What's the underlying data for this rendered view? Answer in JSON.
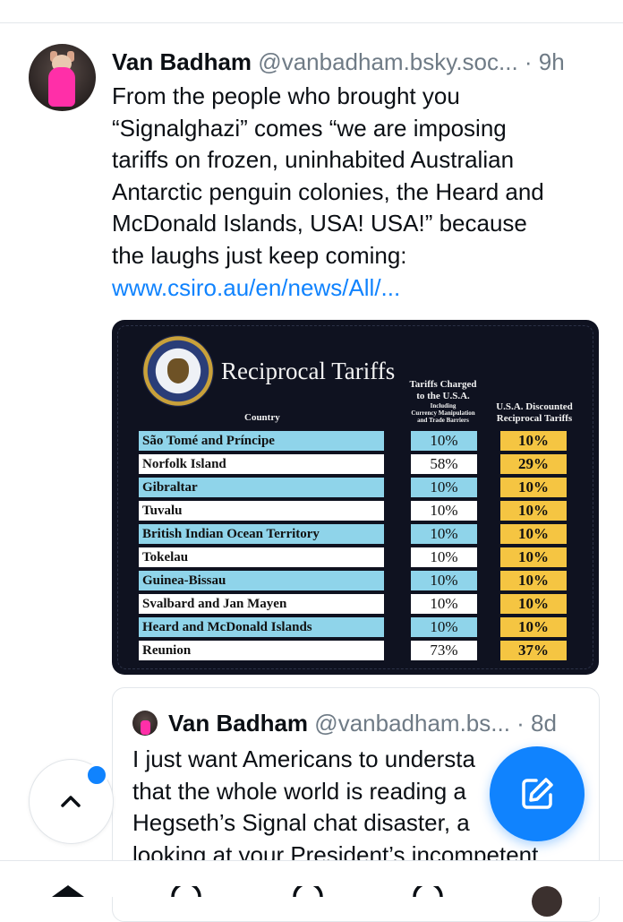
{
  "post": {
    "author": "Van Badham",
    "handle": "@vanbadham.bsky.soc...",
    "time": "· 9h",
    "text_lines": [
      "From the people who brought you",
      "“Signalghazi” comes “we are imposing",
      "tariffs on frozen, uninhabited Australian",
      "Antarctic penguin colonies, the Heard and",
      "McDonald Islands, USA! USA!” because",
      "the laughs just keep coming:"
    ],
    "link": "www.csiro.au/en/news/All/..."
  },
  "embed": {
    "title": "Reciprocal Tariffs",
    "col_country": "Country",
    "col_charged_1": "Tariffs Charged",
    "col_charged_2": "to the U.S.A.",
    "col_charged_3": "Including",
    "col_charged_4": "Currency Manipulation",
    "col_charged_5": "and Trade Barriers",
    "col_disc_1": "U.S.A. Discounted",
    "col_disc_2": "Reciprocal Tariffs",
    "rows": [
      {
        "country": "São Tomé and Príncipe",
        "charged": "10%",
        "discounted": "10%"
      },
      {
        "country": "Norfolk Island",
        "charged": "58%",
        "discounted": "29%"
      },
      {
        "country": "Gibraltar",
        "charged": "10%",
        "discounted": "10%"
      },
      {
        "country": "Tuvalu",
        "charged": "10%",
        "discounted": "10%"
      },
      {
        "country": "British Indian Ocean Territory",
        "charged": "10%",
        "discounted": "10%"
      },
      {
        "country": "Tokelau",
        "charged": "10%",
        "discounted": "10%"
      },
      {
        "country": "Guinea-Bissau",
        "charged": "10%",
        "discounted": "10%"
      },
      {
        "country": "Svalbard and Jan Mayen",
        "charged": "10%",
        "discounted": "10%"
      },
      {
        "country": "Heard and McDonald Islands",
        "charged": "10%",
        "discounted": "10%"
      },
      {
        "country": "Reunion",
        "charged": "73%",
        "discounted": "37%"
      }
    ]
  },
  "quote": {
    "author": "Van Badham",
    "handle": "@vanbadham.bs...",
    "time": "· 8d",
    "text_lines": [
      "I just want Americans to understa",
      "that the whole world is reading a",
      "Hegseth’s Signal chat disaster, a",
      "looking at your President’s incompetent"
    ]
  },
  "icons": {
    "scroll_top": "chevron-up-icon",
    "compose": "compose-icon",
    "nav": [
      "home-icon",
      "search-icon",
      "chat-icon",
      "notifications-icon",
      "profile-avatar"
    ]
  },
  "colors": {
    "accent": "#1083fe",
    "row_blue": "#8fd4ea",
    "row_gold": "#f5c542",
    "table_bg": "#0f1220"
  }
}
